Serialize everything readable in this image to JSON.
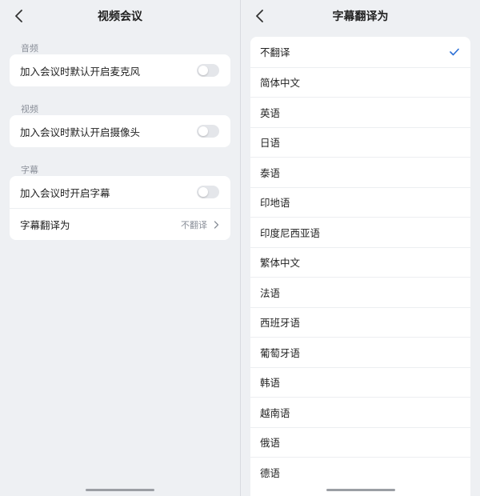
{
  "left": {
    "title": "视频会议",
    "sections": [
      {
        "label": "音频",
        "rows": [
          {
            "label": "加入会议时默认开启麦克风",
            "type": "toggle",
            "on": false
          }
        ]
      },
      {
        "label": "视频",
        "rows": [
          {
            "label": "加入会议时默认开启摄像头",
            "type": "toggle",
            "on": false
          }
        ]
      },
      {
        "label": "字幕",
        "rows": [
          {
            "label": "加入会议时开启字幕",
            "type": "toggle",
            "on": false
          },
          {
            "label": "字幕翻译为",
            "type": "link",
            "value": "不翻译"
          }
        ]
      }
    ]
  },
  "right": {
    "title": "字幕翻译为",
    "selected_index": 0,
    "options": [
      "不翻译",
      "简体中文",
      "英语",
      "日语",
      "泰语",
      "印地语",
      "印度尼西亚语",
      "繁体中文",
      "法语",
      "西班牙语",
      "葡萄牙语",
      "韩语",
      "越南语",
      "俄语",
      "德语"
    ]
  },
  "icons": {
    "back": "chevron-left-icon",
    "arrow": "chevron-right-icon",
    "check": "checkmark-icon"
  },
  "colors": {
    "accent": "#2b6fd6",
    "toggle_off": "#e4e6ea",
    "background": "#eef0f3"
  }
}
